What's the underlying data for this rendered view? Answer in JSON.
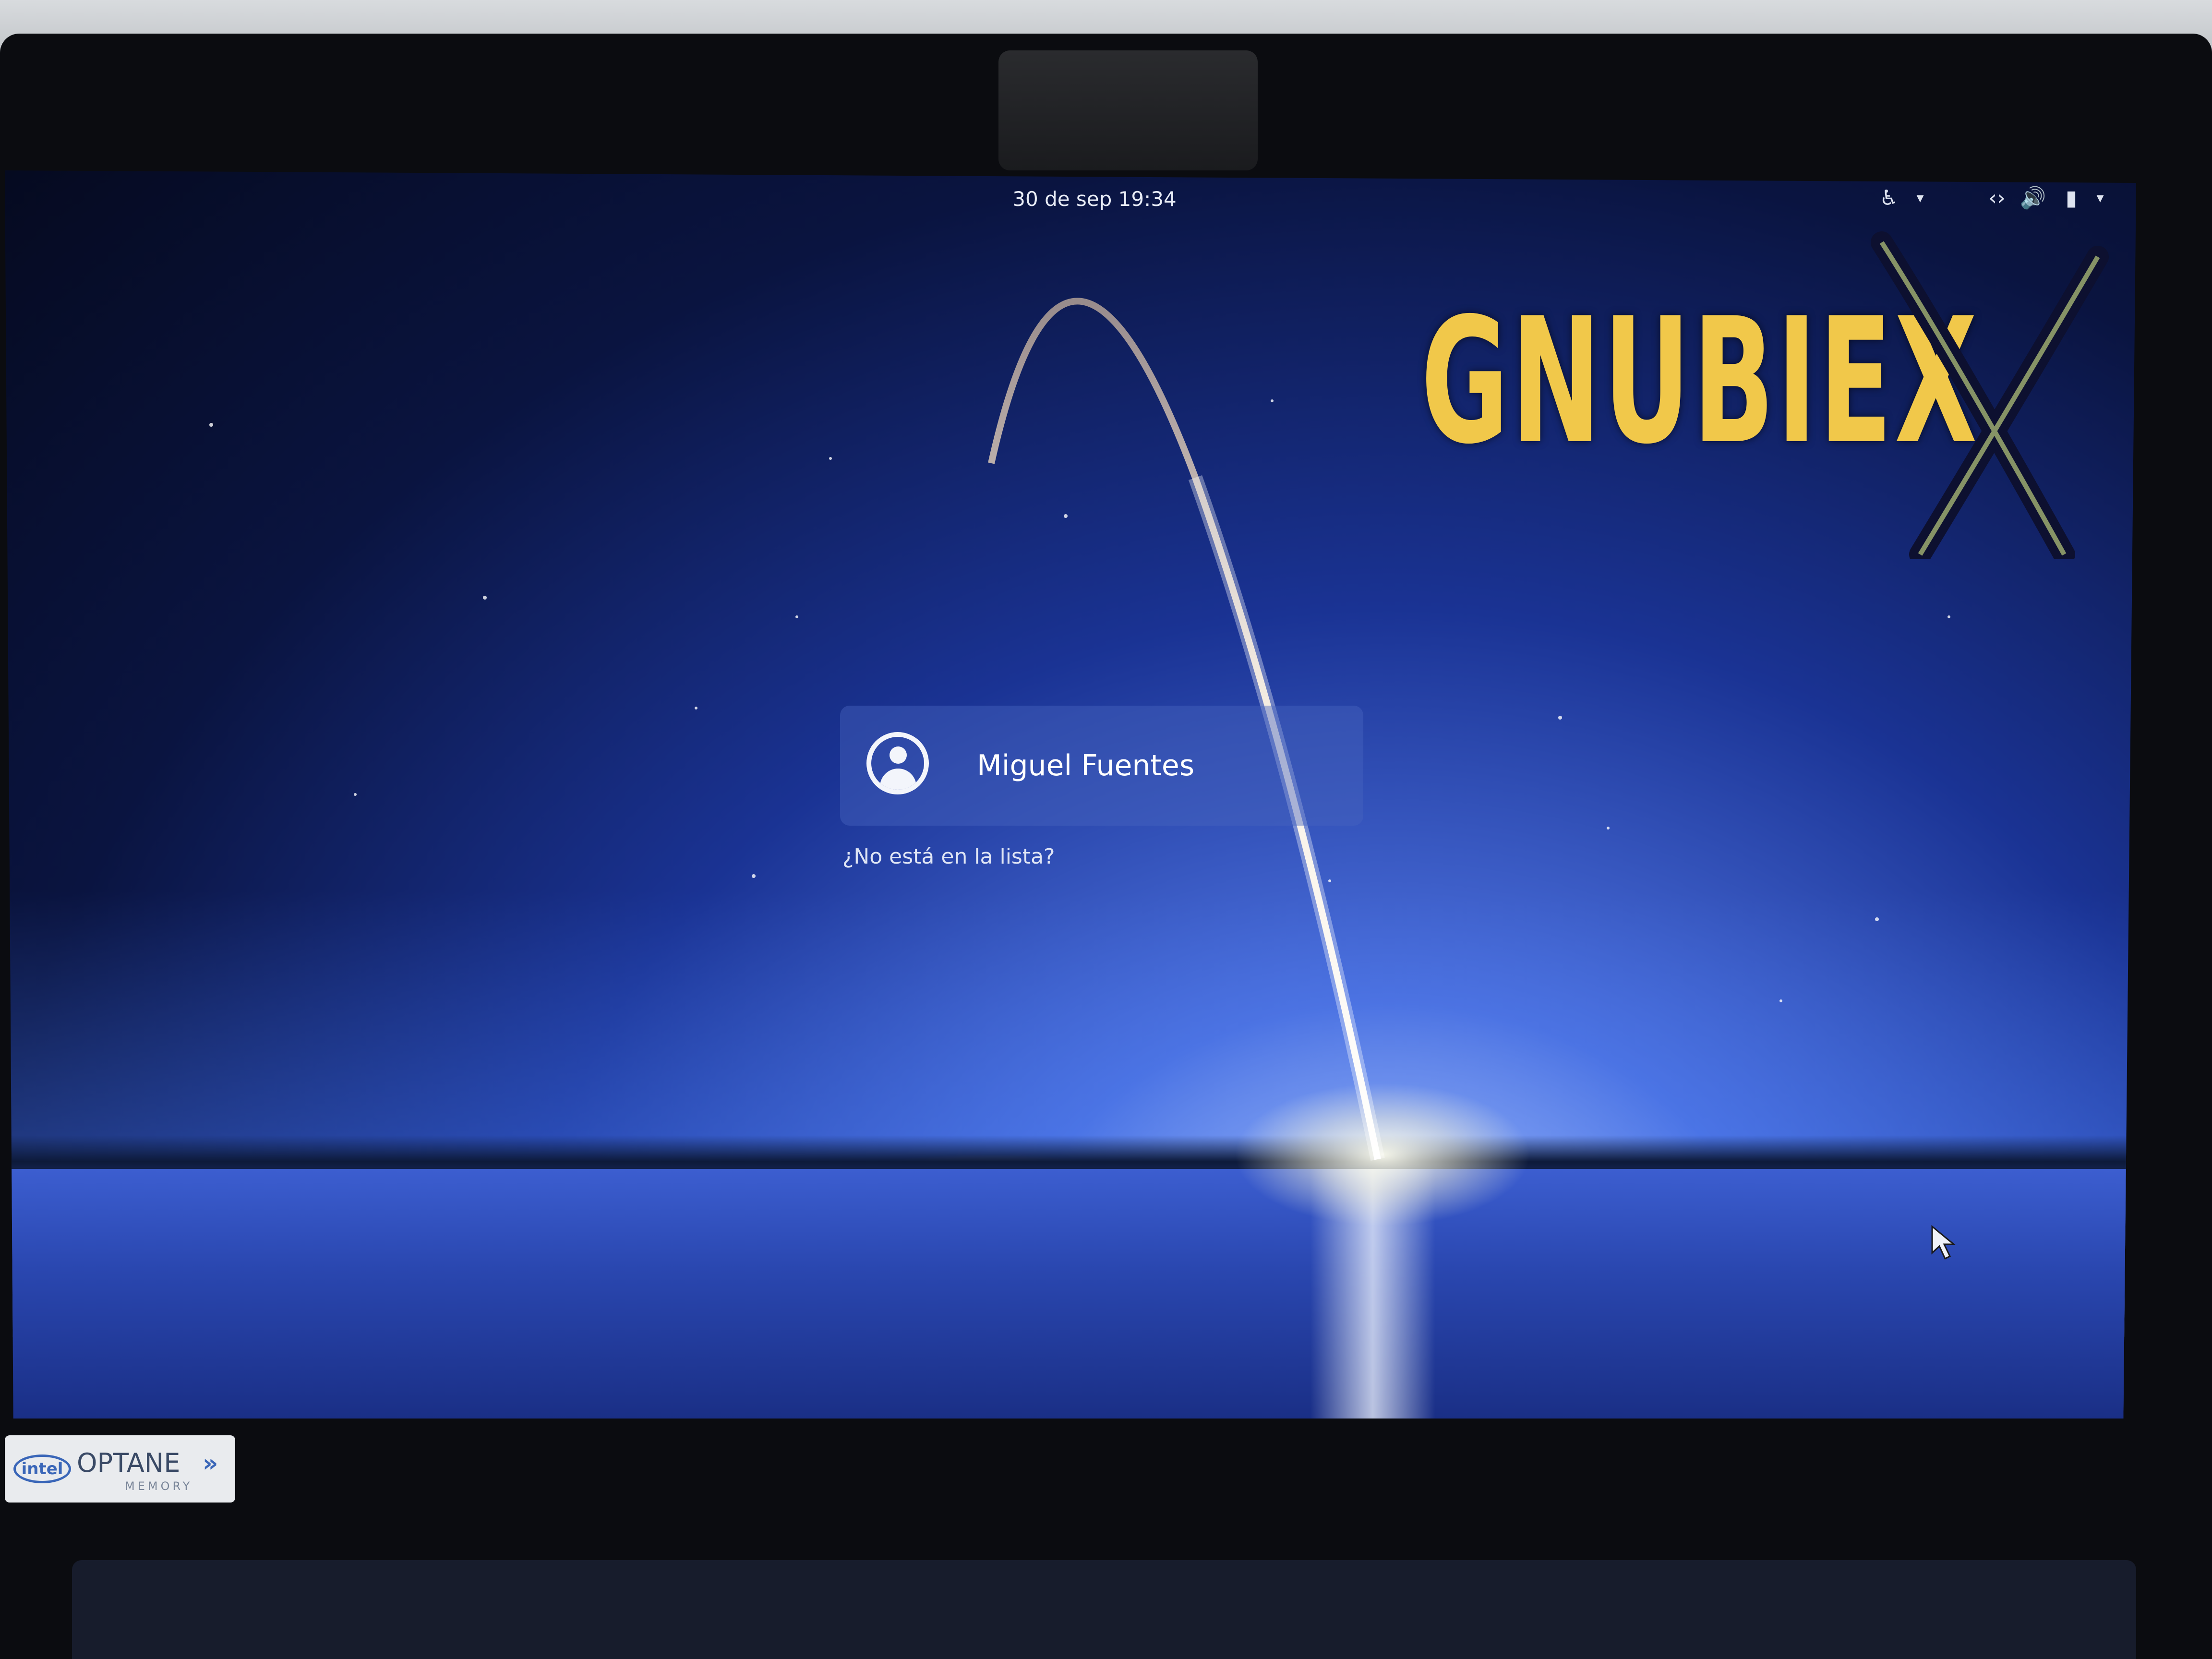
{
  "top_bar": {
    "clock": "30 de sep  19:34",
    "icons": [
      "accessibility-icon",
      "dropdown-icon",
      "network-icon",
      "volume-icon",
      "battery-icon",
      "menu-dropdown-icon"
    ]
  },
  "logo": {
    "text": "GNUBIEX"
  },
  "login": {
    "user_name": "Miguel Fuentes",
    "not_listed_link": "¿No está en la lista?"
  },
  "sticker": {
    "brand": "intel",
    "product": "OPTANE",
    "sub": "MEMORY"
  },
  "colors": {
    "sky_dark": "#050a20",
    "sky_mid": "#1a3394",
    "logo_yellow": "#f1c84a",
    "card_bg": "rgba(70,100,190,0.45)"
  }
}
